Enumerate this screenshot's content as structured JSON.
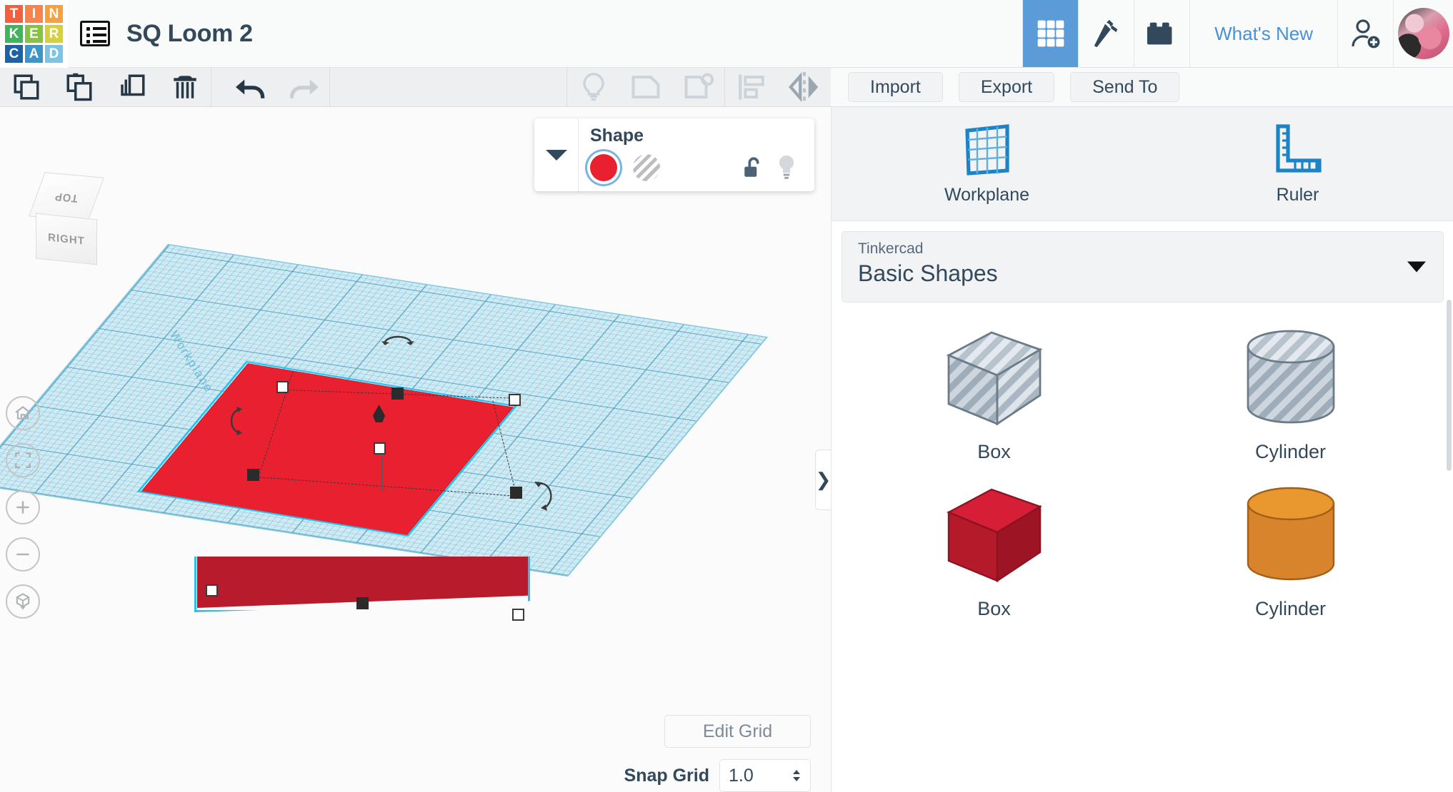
{
  "app": {
    "logo_name": "tinkercad-logo",
    "logo_tiles": [
      {
        "letter": "T",
        "color": "#f4603e"
      },
      {
        "letter": "I",
        "color": "#f9834a"
      },
      {
        "letter": "N",
        "color": "#f9a03c"
      },
      {
        "letter": "K",
        "color": "#3eb55b"
      },
      {
        "letter": "E",
        "color": "#86c440"
      },
      {
        "letter": "R",
        "color": "#d7d036"
      },
      {
        "letter": "C",
        "color": "#1b63a8"
      },
      {
        "letter": "A",
        "color": "#3d95cd"
      },
      {
        "letter": "D",
        "color": "#7bc4e6"
      }
    ]
  },
  "header": {
    "title": "SQ Loom 2",
    "menu_icon": "list-menu-icon",
    "nav": [
      {
        "name": "tab-3d-design",
        "icon": "grid-3x3-icon",
        "active": true
      },
      {
        "name": "tab-minecraft",
        "icon": "pickaxe-icon",
        "active": false
      },
      {
        "name": "tab-bricks",
        "icon": "lego-brick-icon",
        "active": false
      }
    ],
    "whats_new": "What's New",
    "add_user_icon": "add-user-icon",
    "avatar": "user-avatar"
  },
  "toolbar": {
    "left_tools": [
      {
        "name": "copy-button",
        "icon": "copy-icon"
      },
      {
        "name": "paste-button",
        "icon": "clipboard-paste-icon"
      },
      {
        "name": "duplicate-button",
        "icon": "duplicate-icon"
      },
      {
        "name": "delete-button",
        "icon": "trash-icon"
      }
    ],
    "history_tools": [
      {
        "name": "undo-button",
        "icon": "undo-arrow-icon"
      },
      {
        "name": "redo-button",
        "icon": "redo-arrow-icon"
      }
    ],
    "right_tools": [
      {
        "name": "light-button",
        "icon": "lightbulb-icon"
      },
      {
        "name": "group-button",
        "icon": "group-shapes-icon"
      },
      {
        "name": "ungroup-button",
        "icon": "ungroup-shapes-icon"
      },
      {
        "name": "align-button",
        "icon": "align-icon"
      },
      {
        "name": "mirror-button",
        "icon": "mirror-flip-icon"
      }
    ]
  },
  "actions": {
    "import": "Import",
    "export": "Export",
    "send_to": "Send To"
  },
  "viewport": {
    "viewcube": {
      "top_face": "TOP",
      "front_face": "RIGHT"
    },
    "nav_buttons": [
      {
        "name": "home-view-button",
        "icon": "home-icon"
      },
      {
        "name": "fit-to-view-button",
        "icon": "fit-frame-icon"
      },
      {
        "name": "zoom-in-button",
        "icon": "plus-icon"
      },
      {
        "name": "zoom-out-button",
        "icon": "minus-icon"
      },
      {
        "name": "projection-toggle-button",
        "icon": "ortho-cube-icon"
      }
    ],
    "workplane_label": "Workplane",
    "collapse_arrow": "❯",
    "edit_grid": "Edit Grid",
    "snap_grid_label": "Snap Grid",
    "snap_grid_value": "1.0"
  },
  "shape_panel": {
    "title": "Shape",
    "solid_swatch_color": "#e8202f",
    "solid_selected": true,
    "hole_swatch": "hole-hatched-swatch",
    "lock_icon": "unlocked-padlock-icon",
    "light_icon": "lightbulb-icon"
  },
  "sidebar": {
    "tools": [
      {
        "name": "workplane-tool",
        "label": "Workplane",
        "icon": "workplane-grid-icon"
      },
      {
        "name": "ruler-tool",
        "label": "Ruler",
        "icon": "ruler-icon"
      }
    ],
    "library": {
      "owner": "Tinkercad",
      "selected": "Basic Shapes"
    },
    "shapes": [
      {
        "name": "shape-box-hole",
        "label": "Box",
        "kind": "box",
        "style": "hole"
      },
      {
        "name": "shape-cylinder-hole",
        "label": "Cylinder",
        "kind": "cylinder",
        "style": "hole"
      },
      {
        "name": "shape-box-red",
        "label": "Box",
        "kind": "box",
        "style": "solid",
        "color": "#c4182b"
      },
      {
        "name": "shape-cylinder-orange",
        "label": "Cylinder",
        "kind": "cylinder",
        "style": "solid",
        "color": "#e08a2e"
      }
    ]
  },
  "colors": {
    "accent_blue": "#4a90d9",
    "active_tab_blue": "#5b9bd8",
    "text_dark": "#32485b",
    "model_red": "#e8202f",
    "selection_cyan": "#1fc4f4",
    "workplane_blue": "#cfeaf3"
  }
}
